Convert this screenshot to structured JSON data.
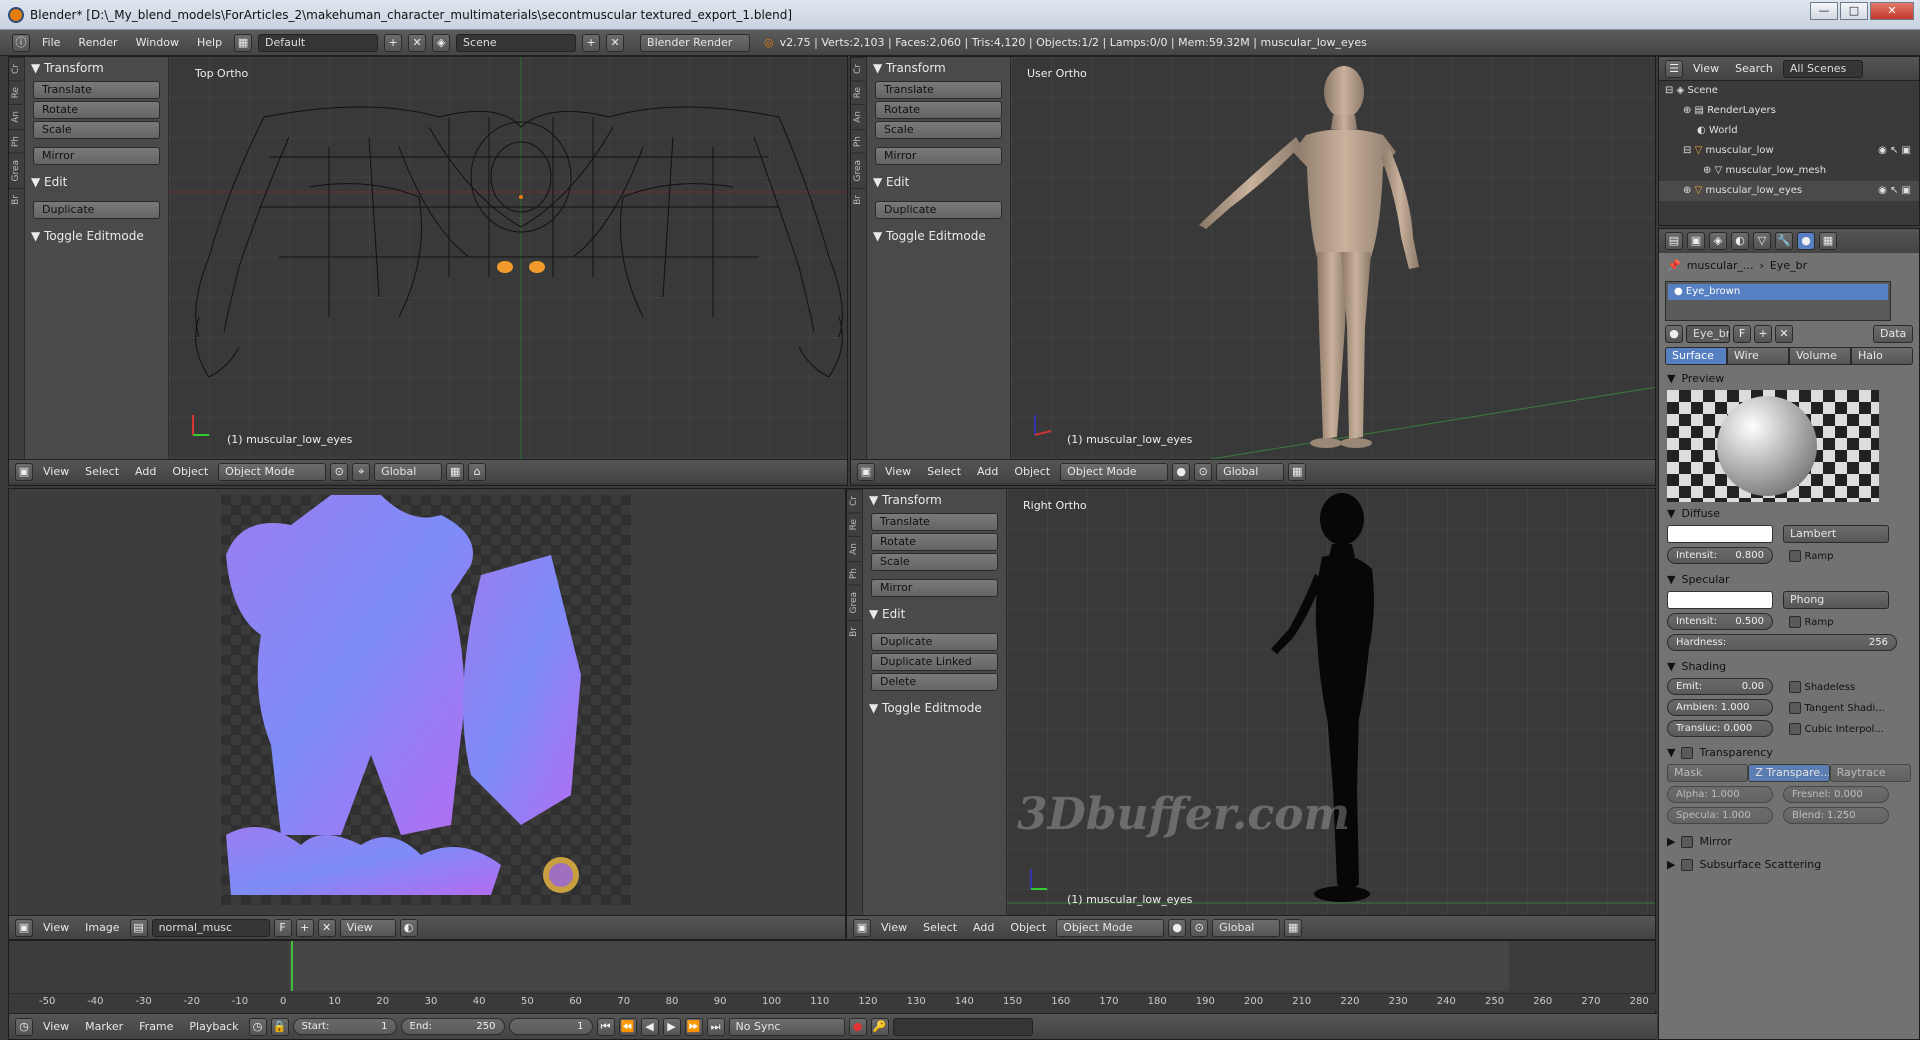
{
  "window": {
    "title": "Blender* [D:\\_My_blend_models\\ForArticles_2\\makehuman_character_multimaterials\\secontmuscular textured_export_1.blend]",
    "minimize": "—",
    "maximize": "□",
    "close": "✕"
  },
  "topbar": {
    "menus": [
      "File",
      "Render",
      "Window",
      "Help"
    ],
    "layout": "Default",
    "scene": "Scene",
    "engine": "Blender Render",
    "stats": "v2.75 | Verts:2,103 | Faces:2,060 | Tris:4,120 | Objects:1/2 | Lamps:0/0 | Mem:59.32M | muscular_low_eyes"
  },
  "tool_tabs": [
    "Cr",
    "Re",
    "An",
    "Ph",
    "Grea",
    "Br"
  ],
  "toolshelf": {
    "transform": "Transform",
    "translate": "Translate",
    "rotate": "Rotate",
    "scale": "Scale",
    "mirror": "Mirror",
    "edit": "Edit",
    "duplicate": "Duplicate",
    "duplicate_linked": "Duplicate Linked",
    "delete": "Delete",
    "toggle_editmode": "Toggle Editmode"
  },
  "views": {
    "top": {
      "label": "Top Ortho",
      "object": "(1) muscular_low_eyes"
    },
    "user": {
      "label": "User Ortho",
      "object": "(1) muscular_low_eyes"
    },
    "right": {
      "label": "Right Ortho",
      "object": "(1) muscular_low_eyes"
    }
  },
  "view3d_header": {
    "view": "View",
    "select": "Select",
    "add": "Add",
    "object": "Object",
    "mode": "Object Mode",
    "orientation": "Global"
  },
  "uv_header": {
    "view": "View",
    "image": "Image",
    "image_name": "normal_musc",
    "f": "F",
    "view2": "View"
  },
  "watermark": "3Dbuffer.com",
  "outliner": {
    "header": {
      "view": "View",
      "search": "Search",
      "scenes": "All Scenes"
    },
    "items": [
      "Scene",
      "RenderLayers",
      "World",
      "muscular_low",
      "muscular_low_mesh",
      "muscular_low_eyes"
    ]
  },
  "properties": {
    "breadcrumb": [
      "muscular_...",
      "Eye_br"
    ],
    "material_slot": "Eye_brown",
    "material_name": "Eye_br",
    "f": "F",
    "data": "Data",
    "tabs": [
      "Surface",
      "Wire",
      "Volume",
      "Halo"
    ],
    "preview": "Preview",
    "diffuse": {
      "title": "Diffuse",
      "shader": "Lambert",
      "intensity_label": "Intensit:",
      "intensity": "0.800",
      "ramp": "Ramp"
    },
    "specular": {
      "title": "Specular",
      "shader": "Phong",
      "intensity_label": "Intensit:",
      "intensity": "0.500",
      "ramp": "Ramp",
      "hardness_label": "Hardness:",
      "hardness": "256"
    },
    "shading": {
      "title": "Shading",
      "emit_label": "Emit:",
      "emit": "0.00",
      "ambient_label": "Ambien: 1.000",
      "transluc_label": "Transluc: 0.000",
      "shadeless": "Shadeless",
      "tangent": "Tangent Shadi...",
      "cubic": "Cubic Interpol..."
    },
    "transparency": {
      "title": "Transparency",
      "mask": "Mask",
      "ztrans": "Z Transpare...",
      "raytrace": "Raytrace",
      "alpha": "Alpha: 1.000",
      "fresnel": "Fresnel: 0.000",
      "specular": "Specula: 1.000",
      "blend": "Blend: 1.250"
    },
    "mirror": "Mirror",
    "sss": "Subsurface Scattering"
  },
  "timeline": {
    "ticks": [
      "-50",
      "-40",
      "-30",
      "-20",
      "-10",
      "0",
      "10",
      "20",
      "30",
      "40",
      "50",
      "60",
      "70",
      "80",
      "90",
      "100",
      "110",
      "120",
      "130",
      "140",
      "150",
      "160",
      "170",
      "180",
      "190",
      "200",
      "210",
      "220",
      "230",
      "240",
      "250",
      "260",
      "270",
      "280"
    ],
    "view": "View",
    "marker": "Marker",
    "frame": "Frame",
    "playback": "Playback",
    "start_label": "Start:",
    "start": "1",
    "end_label": "End:",
    "end": "250",
    "current": "1",
    "sync": "No Sync"
  },
  "colors": {
    "accent": "#5680c2",
    "orange": "#e87d0d",
    "normal_map": "#8080ff"
  }
}
